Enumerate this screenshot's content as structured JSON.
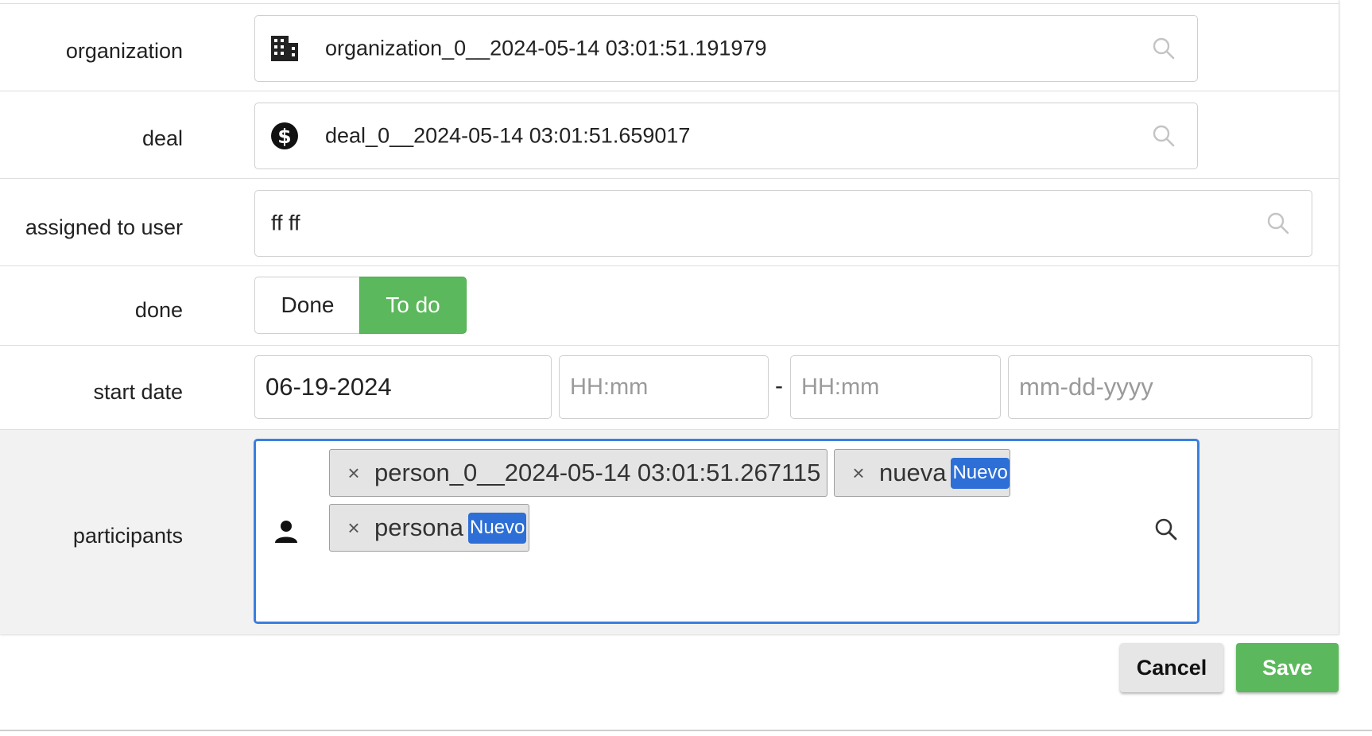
{
  "fields": {
    "organization": {
      "label": "organization",
      "value": "organization_0__2024-05-14 03:01:51.191979",
      "icon": "building-icon"
    },
    "deal": {
      "label": "deal",
      "value": "deal_0__2024-05-14 03:01:51.659017",
      "icon": "dollar-circle-icon"
    },
    "assigned_to_user": {
      "label": "assigned to user",
      "value": "ff ff"
    },
    "done": {
      "label": "done",
      "options": [
        "Done",
        "To do"
      ],
      "selected": "To do"
    },
    "start_date": {
      "label": "start date",
      "date_value": "06-19-2024",
      "start_time_placeholder": "HH:mm",
      "separator": "-",
      "end_time_placeholder": "HH:mm",
      "end_date_placeholder": "mm-dd-yyyy"
    },
    "participants": {
      "label": "participants",
      "icon": "person-icon",
      "chips": [
        {
          "label": "person_0__2024-05-14 03:01:51.267115",
          "badge": ""
        },
        {
          "label": "nueva",
          "badge": "Nuevo"
        },
        {
          "label": "persona",
          "badge": "Nuevo"
        }
      ],
      "remove_glyph": "×"
    }
  },
  "actions": {
    "cancel_label": "Cancel",
    "save_label": "Save"
  },
  "colors": {
    "accent_green": "#5cb85c",
    "focus_blue": "#2d6fd6",
    "badge_blue": "#2d6fd6",
    "participants_row_bg": "#f2f2f2"
  }
}
